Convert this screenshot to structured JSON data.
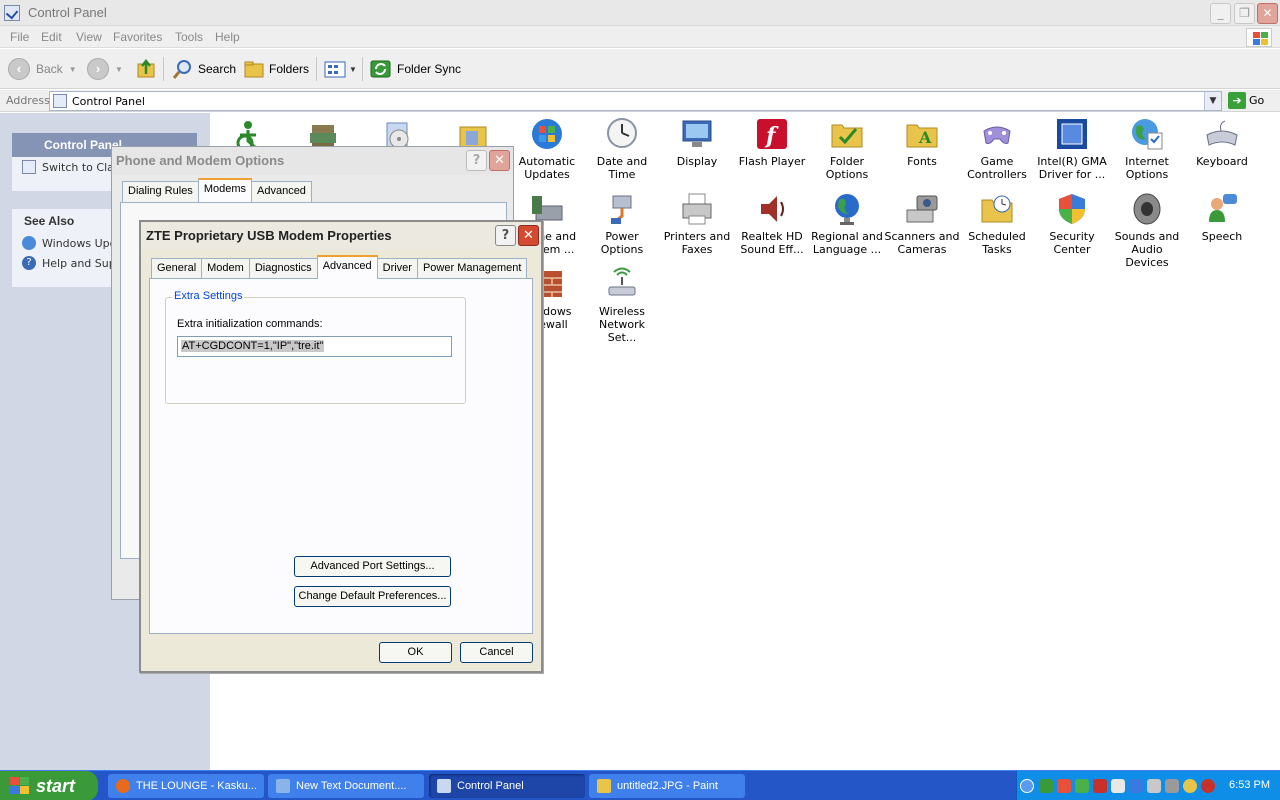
{
  "window": {
    "title": "Control Panel"
  },
  "menu": [
    "File",
    "Edit",
    "View",
    "Favorites",
    "Tools",
    "Help"
  ],
  "toolbar": {
    "back": "Back",
    "search": "Search",
    "folders": "Folders",
    "folder_sync": "Folder Sync"
  },
  "address": {
    "label": "Address",
    "value": "Control Panel",
    "go": "Go"
  },
  "leftpane": {
    "cp_title": "Control Panel",
    "switch_link": "Switch to Classic View",
    "see_also_title": "See Also",
    "see_also": [
      "Windows Update",
      "Help and Support"
    ]
  },
  "icons": [
    {
      "label": "Automatic Updates",
      "icon": "automatic-updates-icon",
      "color": "#2a7ad8"
    },
    {
      "label": "Date and Time",
      "icon": "clock-icon",
      "color": "#9aa4b0"
    },
    {
      "label": "Display",
      "icon": "display-icon",
      "color": "#3a6ab8"
    },
    {
      "label": "Flash Player",
      "icon": "flash-icon",
      "color": "#c8102e"
    },
    {
      "label": "Folder Options",
      "icon": "folder-options-icon",
      "color": "#e8c44a"
    },
    {
      "label": "Fonts",
      "icon": "fonts-folder-icon",
      "color": "#e8c44a"
    },
    {
      "label": "Game Controllers",
      "icon": "gamepad-icon",
      "color": "#8a70c8"
    },
    {
      "label": "Intel(R) GMA Driver for ...",
      "icon": "intel-gma-icon",
      "color": "#1a4aa0"
    },
    {
      "label": "Internet Options",
      "icon": "globe-icon",
      "color": "#2a8a4a"
    },
    {
      "label": "Keyboard",
      "icon": "keyboard-icon",
      "color": "#7a8090"
    },
    {
      "label": "Phone and Modem ...",
      "icon": "phone-modem-icon",
      "color": "#4a7a4a"
    },
    {
      "label": "Power Options",
      "icon": "power-options-icon",
      "color": "#d87a2a"
    },
    {
      "label": "Printers and Faxes",
      "icon": "printer-icon",
      "color": "#8a8a8a"
    },
    {
      "label": "Realtek HD Sound Eff...",
      "icon": "speaker-icon",
      "color": "#a0302a"
    },
    {
      "label": "Regional and Language ...",
      "icon": "globe-icon",
      "color": "#2a6ac8"
    },
    {
      "label": "Scanners and Cameras",
      "icon": "scanner-icon",
      "color": "#8a8a8a"
    },
    {
      "label": "Scheduled Tasks",
      "icon": "scheduled-tasks-icon",
      "color": "#e8c44a"
    },
    {
      "label": "Security Center",
      "icon": "shield-icon",
      "color": "#c8302a"
    },
    {
      "label": "Sounds and Audio Devices",
      "icon": "speaker-icon",
      "color": "#6a6a6a"
    },
    {
      "label": "Speech",
      "icon": "speech-icon",
      "color": "#4a8ad8"
    },
    {
      "label": "Windows Firewall",
      "icon": "firewall-icon",
      "color": "#a04020"
    },
    {
      "label": "Wireless Network Set...",
      "icon": "wireless-icon",
      "color": "#3a9a3a"
    }
  ],
  "phone_dialog": {
    "title": "Phone and Modem Options",
    "tabs": [
      "Dialing Rules",
      "Modems",
      "Advanced"
    ]
  },
  "modem_dialog": {
    "title": "ZTE Proprietary USB Modem Properties",
    "tabs": [
      "General",
      "Modem",
      "Diagnostics",
      "Advanced",
      "Driver",
      "Power Management"
    ],
    "group_title": "Extra Settings",
    "field_label": "Extra initialization commands:",
    "field_value": "AT+CGDCONT=1,\"IP\",\"tre.it\"",
    "adv_port_btn": "Advanced Port Settings...",
    "change_pref_btn": "Change Default Preferences...",
    "ok": "OK",
    "cancel": "Cancel"
  },
  "taskbar": {
    "start": "start",
    "tasks": [
      {
        "label": "THE LOUNGE - Kasku...",
        "color": "#e86a1a"
      },
      {
        "label": "New Text Document....",
        "color": "#8ab4e8"
      },
      {
        "label": "Control Panel",
        "color": "#c8d8f0"
      },
      {
        "label": "untitled2.JPG - Paint",
        "color": "#e8c44a"
      }
    ],
    "clock": "6:53 PM"
  }
}
